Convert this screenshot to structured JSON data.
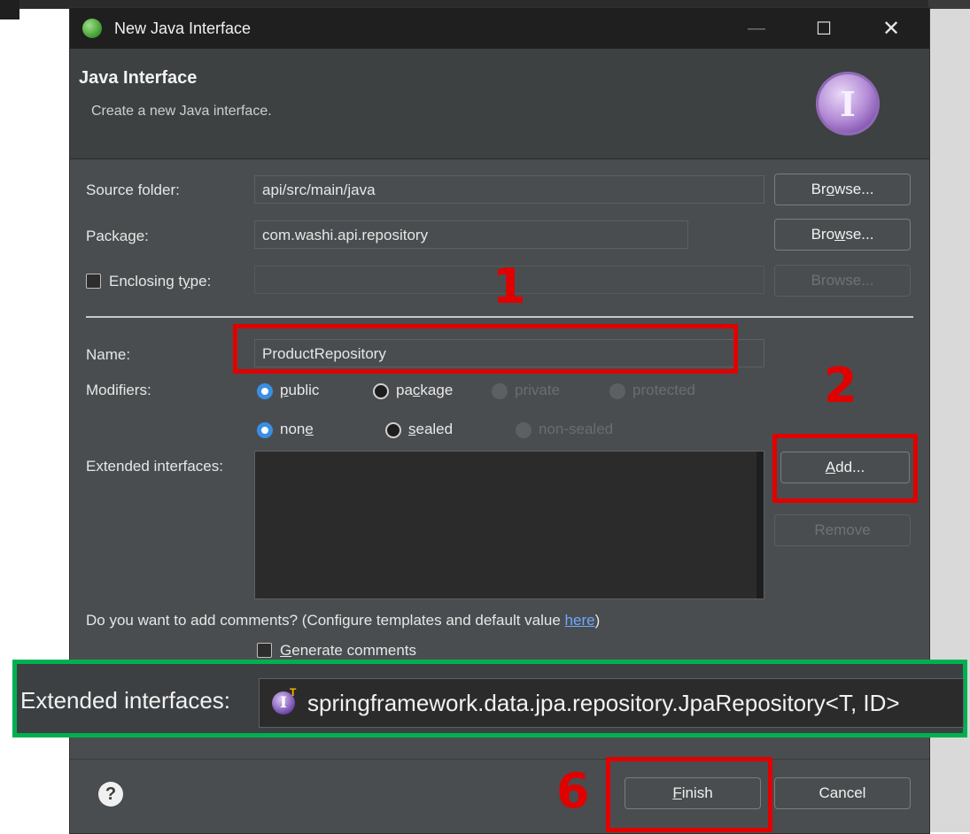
{
  "dialog": {
    "title": "New Java Interface",
    "window_controls": {
      "minimize": "—",
      "maximize": "☐",
      "close": "✕"
    }
  },
  "header": {
    "title": "Java Interface",
    "description": "Create a new Java interface.",
    "emblem_glyph": "I"
  },
  "form": {
    "source_folder": {
      "label": "Source folder:",
      "value": "api/src/main/java",
      "browse_pre": "Br",
      "browse_mn": "o",
      "browse_post": "wse..."
    },
    "package": {
      "label": "Package:",
      "value": "com.washi.api.repository",
      "browse_pre": "Bro",
      "browse_mn": "w",
      "browse_post": "se..."
    },
    "enclosing_type": {
      "label_pre": "Enclosing t",
      "label_mn": "y",
      "label_post": "pe:",
      "value": "",
      "browse": "Browse..."
    },
    "name": {
      "label": "Name:",
      "value": "ProductRepository"
    },
    "modifiers": {
      "label": "Modifiers:",
      "public_mn": "p",
      "public_rest": "ublic",
      "package_pre": "pa",
      "package_mn": "c",
      "package_post": "kage",
      "private": "private",
      "protected": "protected",
      "none_pre": "non",
      "none_mn": "e",
      "sealed_mn": "s",
      "sealed_rest": "ealed",
      "non_sealed": "non-sealed"
    },
    "extended_interfaces": {
      "label": "Extended interfaces:",
      "add_mn": "A",
      "add_rest": "dd...",
      "remove": "Remove"
    },
    "comments": {
      "question": "Do you want to add comments? (Configure templates and default value ",
      "link": "here",
      "close_paren": ")",
      "generate_mn": "G",
      "generate_rest": "enerate comments"
    }
  },
  "overlay": {
    "label": "Extended interfaces:",
    "icon_glyph": "I",
    "icon_badge": "T",
    "value": "springframework.data.jpa.repository.JpaRepository<T, ID>"
  },
  "footer": {
    "help_glyph": "?",
    "finish_mn": "F",
    "finish_rest": "inish",
    "cancel": "Cancel"
  },
  "annotations": {
    "step1": "1",
    "step2": "2",
    "step6": "6"
  },
  "colors": {
    "annotation_red": "#e00000",
    "annotation_green": "#00b050",
    "radio_blue": "#3a8ee6"
  }
}
